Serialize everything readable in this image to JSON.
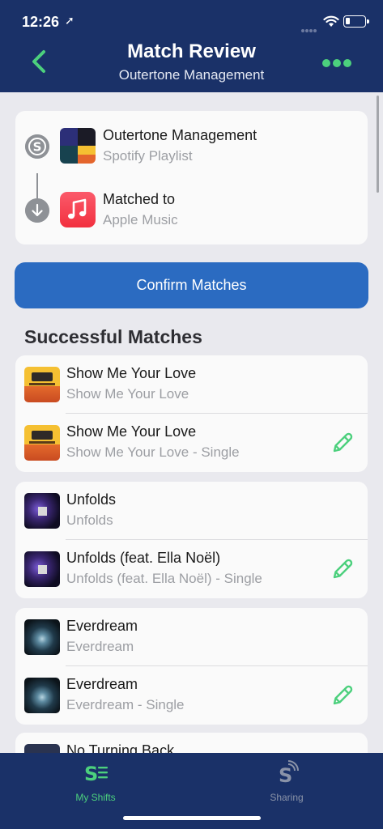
{
  "status_bar": {
    "time": "12:26",
    "location_glyph": "➚"
  },
  "header": {
    "title": "Match Review",
    "subtitle": "Outertone Management",
    "back_icon": "chevron-left-icon",
    "more_icon": "ellipsis-icon",
    "accent_color": "#4cd07d",
    "background_color": "#1a3168"
  },
  "source": {
    "playlist_name": "Outertone Management",
    "playlist_source": "Spotify Playlist",
    "matched_label": "Matched to",
    "destination": "Apple Music"
  },
  "confirm_button": {
    "label": "Confirm Matches",
    "color": "#2b6bc1"
  },
  "section_title": "Successful Matches",
  "matches": [
    {
      "art": "yellow",
      "original": {
        "title": "Show Me Your Love",
        "subtitle": "Show Me Your Love"
      },
      "matched": {
        "title": "Show Me Your Love",
        "subtitle": "Show Me Your Love - Single"
      }
    },
    {
      "art": "purple",
      "original": {
        "title": "Unfolds",
        "subtitle": "Unfolds"
      },
      "matched": {
        "title": "Unfolds (feat. Ella Noël)",
        "subtitle": "Unfolds (feat. Ella Noël) - Single"
      }
    },
    {
      "art": "dark",
      "original": {
        "title": "Everdream",
        "subtitle": "Everdream"
      },
      "matched": {
        "title": "Everdream",
        "subtitle": "Everdream - Single"
      }
    }
  ],
  "partial_match": {
    "title": "No Turning Back"
  },
  "tabbar": {
    "tabs": [
      {
        "label": "My Shifts",
        "icon": "shifts-list-icon",
        "active": true,
        "color": "#4cd07d"
      },
      {
        "label": "Sharing",
        "icon": "sharing-icon",
        "active": false,
        "color": "#8a93a8"
      }
    ]
  }
}
